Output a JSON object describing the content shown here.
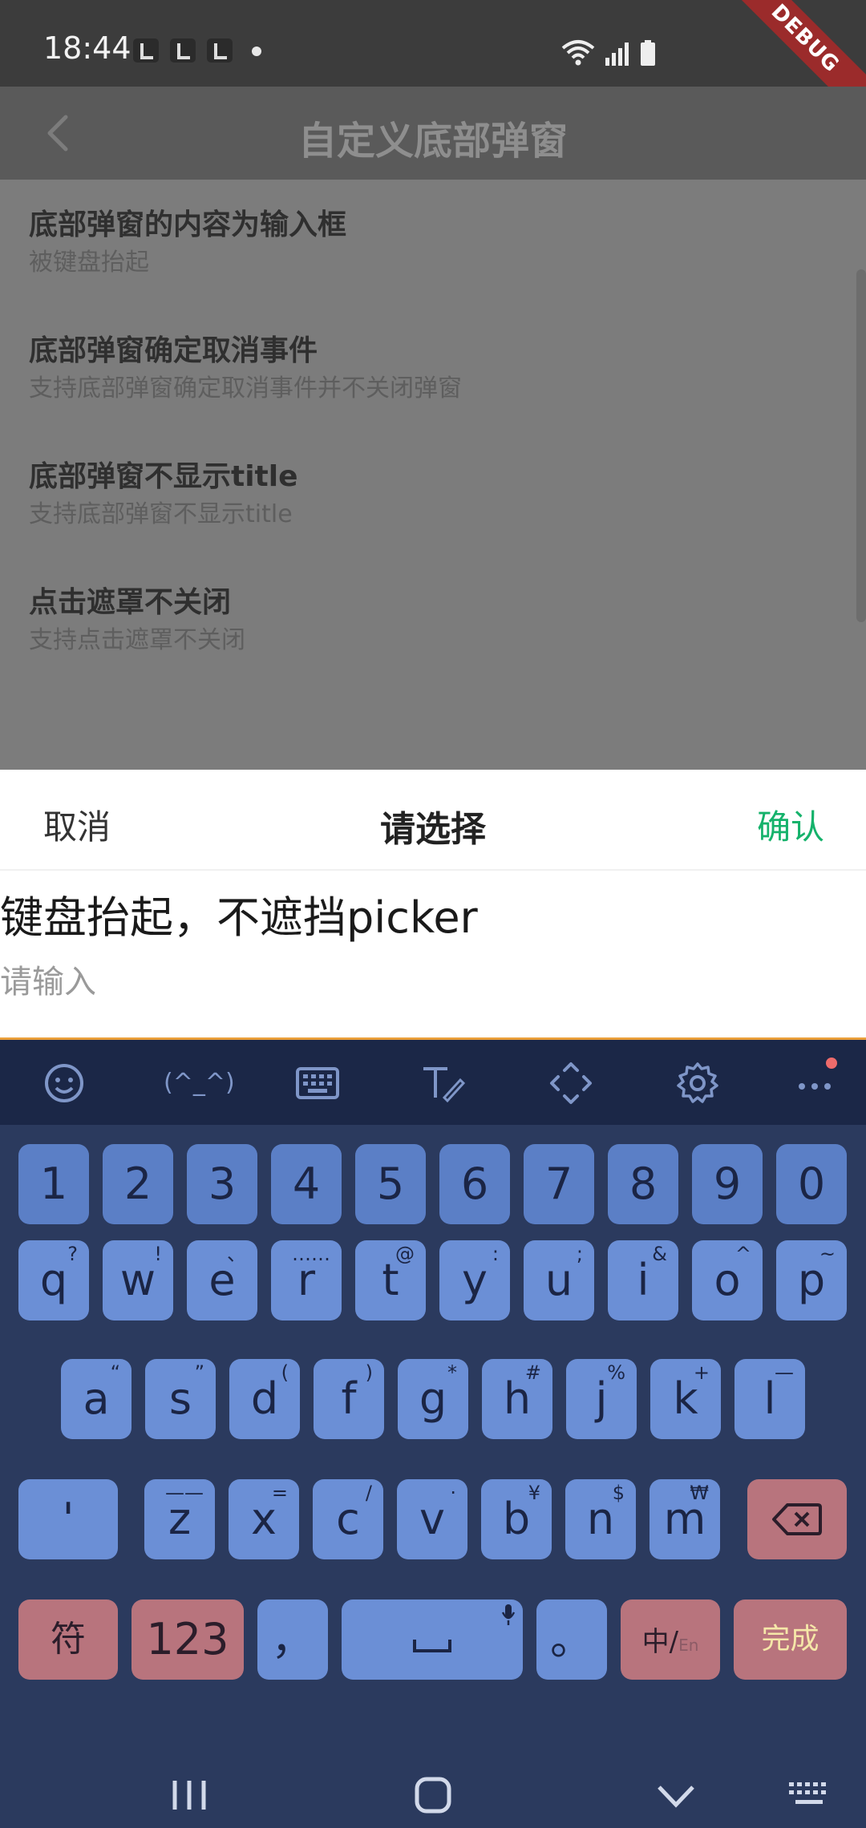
{
  "status_bar": {
    "time": "18:44",
    "debug_label": "DEBUG"
  },
  "app_bar": {
    "title": "自定义底部弹窗"
  },
  "list": {
    "items": [
      {
        "title": "底部弹窗的内容为输入框",
        "subtitle": "被键盘抬起"
      },
      {
        "title": "底部弹窗确定取消事件",
        "subtitle": "支持底部弹窗确定取消事件并不关闭弹窗"
      },
      {
        "title": "底部弹窗不显示title",
        "subtitle": "支持底部弹窗不显示title"
      },
      {
        "title": "点击遮罩不关闭",
        "subtitle": "支持点击遮罩不关闭"
      }
    ]
  },
  "sheet": {
    "cancel_label": "取消",
    "title": "请选择",
    "confirm_label": "确认",
    "description": "键盘抬起，不遮挡picker",
    "input_placeholder": "请输入",
    "input_value": ""
  },
  "keyboard": {
    "number_row": [
      "1",
      "2",
      "3",
      "4",
      "5",
      "6",
      "7",
      "8",
      "9",
      "0"
    ],
    "row1": [
      {
        "key": "q",
        "sup": "?"
      },
      {
        "key": "w",
        "sup": "!"
      },
      {
        "key": "e",
        "sup": "、"
      },
      {
        "key": "r",
        "sup": "……"
      },
      {
        "key": "t",
        "sup": "@"
      },
      {
        "key": "y",
        "sup": ":"
      },
      {
        "key": "u",
        "sup": ";"
      },
      {
        "key": "i",
        "sup": "&"
      },
      {
        "key": "o",
        "sup": "^"
      },
      {
        "key": "p",
        "sup": "~"
      }
    ],
    "row2": [
      {
        "key": "a",
        "sup": "“"
      },
      {
        "key": "s",
        "sup": "”"
      },
      {
        "key": "d",
        "sup": "("
      },
      {
        "key": "f",
        "sup": ")"
      },
      {
        "key": "g",
        "sup": "*"
      },
      {
        "key": "h",
        "sup": "#"
      },
      {
        "key": "j",
        "sup": "%"
      },
      {
        "key": "k",
        "sup": "+"
      },
      {
        "key": "l",
        "sup": "—"
      }
    ],
    "row3_left": "'",
    "row3": [
      {
        "key": "z",
        "sup": "——"
      },
      {
        "key": "x",
        "sup": "="
      },
      {
        "key": "c",
        "sup": "/"
      },
      {
        "key": "v",
        "sup": "·"
      },
      {
        "key": "b",
        "sup": "¥"
      },
      {
        "key": "n",
        "sup": "$"
      },
      {
        "key": "m",
        "sup": "₩"
      }
    ],
    "symbol_key": "符",
    "numeric_key": "123",
    "comma_key": "，",
    "period_key": "。",
    "lang_key_main": "中/",
    "lang_key_alt": "En",
    "done_key": "完成",
    "toolbar_face_text": "(^_^)"
  },
  "colors": {
    "confirm": "#15b26b",
    "key_blue": "#6b8fd6",
    "key_red": "#b8747d",
    "keyboard_bg": "#2b3a5e",
    "input_underline": "#e99e3a"
  }
}
